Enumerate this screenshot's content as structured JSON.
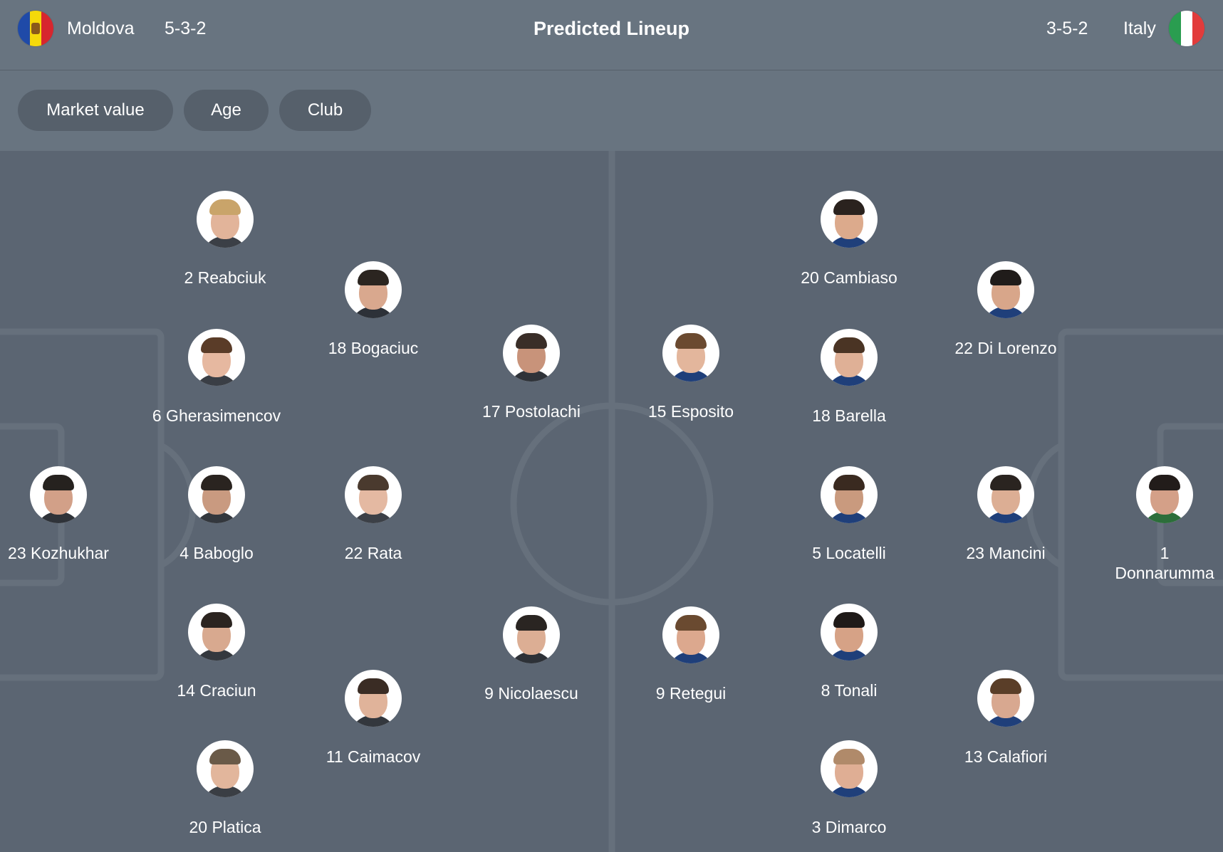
{
  "header": {
    "home_team": "Moldova",
    "home_formation": "5-3-2",
    "title": "Predicted Lineup",
    "away_formation": "3-5-2",
    "away_team": "Italy",
    "home_flag_colors": [
      "#1f4aa8",
      "#f5d90a",
      "#d7262e"
    ],
    "away_flag_colors": [
      "#2a9d50",
      "#ffffff",
      "#e23b3b"
    ]
  },
  "filters": [
    {
      "label": "Market value"
    },
    {
      "label": "Age"
    },
    {
      "label": "Club"
    }
  ],
  "players": [
    {
      "num_name": "2 Reabciuk",
      "team": "home",
      "icon": "player-photo"
    },
    {
      "num_name": "18 Bogaciuc",
      "team": "home",
      "icon": "player-photo"
    },
    {
      "num_name": "6 Gherasimencov",
      "team": "home",
      "icon": "player-photo"
    },
    {
      "num_name": "17 Postolachi",
      "team": "home",
      "icon": "player-photo"
    },
    {
      "num_name": "23 Kozhukhar",
      "team": "home",
      "icon": "player-photo"
    },
    {
      "num_name": "4 Baboglo",
      "team": "home",
      "icon": "player-photo"
    },
    {
      "num_name": "22 Rata",
      "team": "home",
      "icon": "player-photo"
    },
    {
      "num_name": "14 Craciun",
      "team": "home",
      "icon": "player-photo"
    },
    {
      "num_name": "9 Nicolaescu",
      "team": "home",
      "icon": "player-photo"
    },
    {
      "num_name": "11 Caimacov",
      "team": "home",
      "icon": "player-photo"
    },
    {
      "num_name": "20 Platica",
      "team": "home",
      "icon": "player-photo"
    },
    {
      "num_name": "20 Cambiaso",
      "team": "away",
      "icon": "player-photo"
    },
    {
      "num_name": "22 Di Lorenzo",
      "team": "away",
      "icon": "player-photo"
    },
    {
      "num_name": "15 Esposito",
      "team": "away",
      "icon": "player-photo"
    },
    {
      "num_name": "18 Barella",
      "team": "away",
      "icon": "player-photo"
    },
    {
      "num_name": "5 Locatelli",
      "team": "away",
      "icon": "player-photo"
    },
    {
      "num_name": "23 Mancini",
      "team": "away",
      "icon": "player-photo"
    },
    {
      "num_name": "1 Donnarumma",
      "team": "away",
      "icon": "player-photo"
    },
    {
      "num_name": "9 Retegui",
      "team": "away",
      "icon": "player-photo"
    },
    {
      "num_name": "8 Tonali",
      "team": "away",
      "icon": "player-photo"
    },
    {
      "num_name": "13 Calafiori",
      "team": "away",
      "icon": "player-photo"
    },
    {
      "num_name": "3 Dimarco",
      "team": "away",
      "icon": "player-photo"
    }
  ]
}
